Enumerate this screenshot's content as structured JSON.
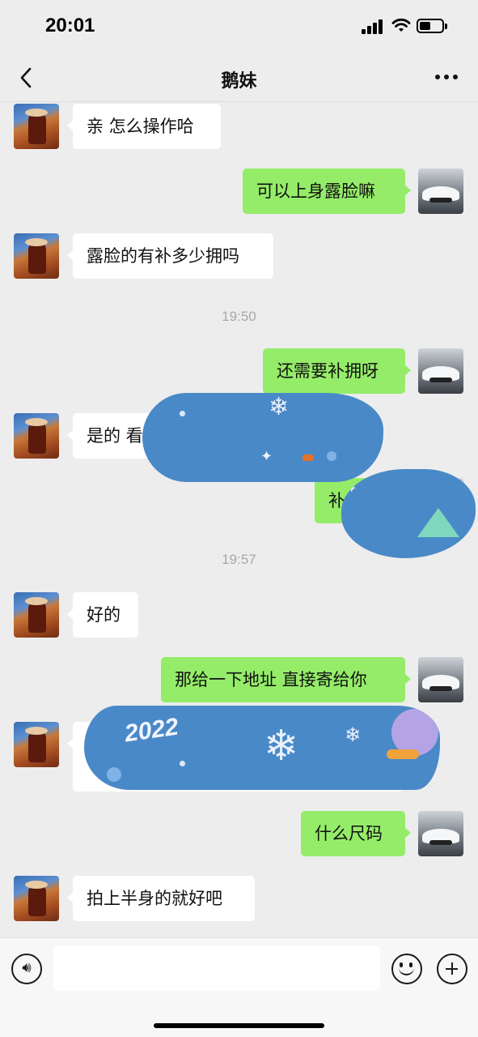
{
  "status_bar": {
    "time": "20:01",
    "battery_level": 0.5,
    "icons": [
      "cellular-signal-icon",
      "wifi-icon",
      "battery-icon"
    ]
  },
  "nav": {
    "title": "鹅妹",
    "back_icon": "chevron-left-icon",
    "more_icon": "more-dots-icon"
  },
  "messages": [
    {
      "side": "in",
      "text": "亲 怎么操作哈"
    },
    {
      "side": "out",
      "text": "可以上身露脸嘛"
    },
    {
      "side": "in",
      "text": "露脸的有补多少拥吗"
    },
    {
      "type": "time",
      "text": "19:50"
    },
    {
      "side": "out",
      "text": "还需要补拥呀"
    },
    {
      "side": "in",
      "text": "是的 看",
      "obscured": true
    },
    {
      "side": "out",
      "text": "补",
      "obscured": true
    },
    {
      "type": "time",
      "text": "19:57"
    },
    {
      "side": "in",
      "text": "好的"
    },
    {
      "side": "out",
      "text": "那给一下地址 直接寄给你"
    },
    {
      "side": "in",
      "text": "",
      "obscured": true
    },
    {
      "side": "out",
      "text": "什么尺码"
    },
    {
      "side": "in",
      "text": "拍上半身的就好吧"
    }
  ],
  "redaction_stickers": {
    "year_text": "2022"
  },
  "input_bar": {
    "text_value": "",
    "voice_icon": "voice-input-icon",
    "emoji_icon": "emoji-icon",
    "plus_icon": "plus-circle-icon"
  },
  "colors": {
    "background": "#ededed",
    "incoming_bubble": "#ffffff",
    "outgoing_bubble": "#95ec69",
    "timestamp": "#a8a8a8",
    "sticker_blue": "#4a89c8"
  }
}
